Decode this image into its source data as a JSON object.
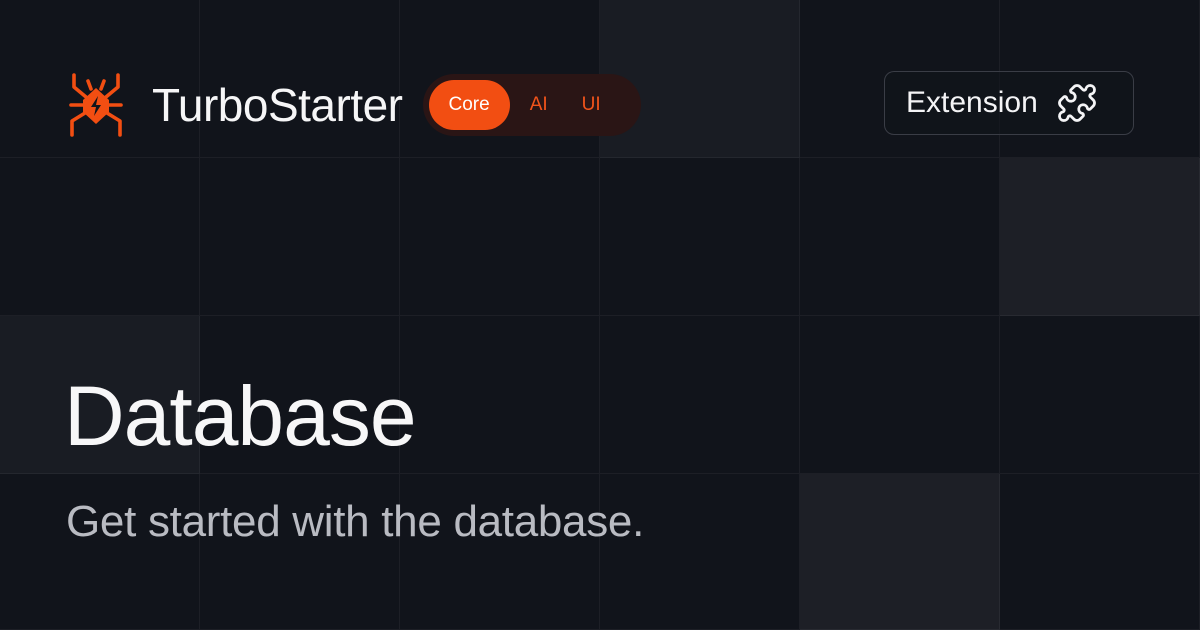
{
  "brand": {
    "name": "TurboStarter",
    "logo_icon": "spider-bolt-icon",
    "accent_color": "#f24e12"
  },
  "tabs": [
    {
      "label": "Core",
      "active": true
    },
    {
      "label": "AI",
      "active": false
    },
    {
      "label": "UI",
      "active": false
    }
  ],
  "extension_button": {
    "label": "Extension",
    "icon": "puzzle-icon"
  },
  "content": {
    "title": "Database",
    "subtitle": "Get started with the database."
  }
}
